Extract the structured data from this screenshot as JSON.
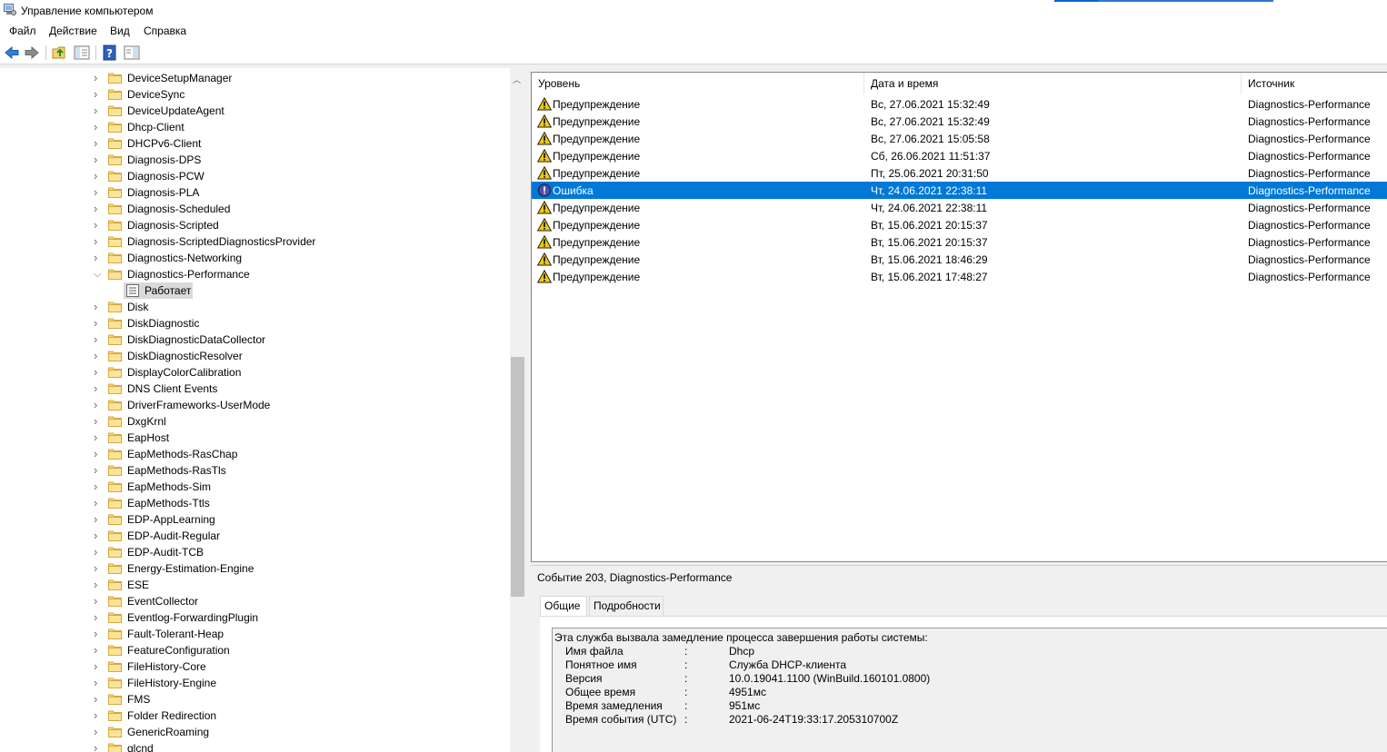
{
  "window": {
    "title": "Управление компьютером"
  },
  "menu": [
    "Файл",
    "Действие",
    "Вид",
    "Справка"
  ],
  "tree": {
    "items": [
      {
        "label": "DeviceSetupManager"
      },
      {
        "label": "DeviceSync"
      },
      {
        "label": "DeviceUpdateAgent"
      },
      {
        "label": "Dhcp-Client"
      },
      {
        "label": "DHCPv6-Client"
      },
      {
        "label": "Diagnosis-DPS"
      },
      {
        "label": "Diagnosis-PCW"
      },
      {
        "label": "Diagnosis-PLA"
      },
      {
        "label": "Diagnosis-Scheduled"
      },
      {
        "label": "Diagnosis-Scripted"
      },
      {
        "label": "Diagnosis-ScriptedDiagnosticsProvider"
      },
      {
        "label": "Diagnostics-Networking"
      },
      {
        "label": "Diagnostics-Performance",
        "expanded": true
      },
      {
        "label": "Работает",
        "child": true,
        "selected": true
      },
      {
        "label": "Disk"
      },
      {
        "label": "DiskDiagnostic"
      },
      {
        "label": "DiskDiagnosticDataCollector"
      },
      {
        "label": "DiskDiagnosticResolver"
      },
      {
        "label": "DisplayColorCalibration"
      },
      {
        "label": "DNS Client Events"
      },
      {
        "label": "DriverFrameworks-UserMode"
      },
      {
        "label": "DxgKrnl"
      },
      {
        "label": "EapHost"
      },
      {
        "label": "EapMethods-RasChap"
      },
      {
        "label": "EapMethods-RasTls"
      },
      {
        "label": "EapMethods-Sim"
      },
      {
        "label": "EapMethods-Ttls"
      },
      {
        "label": "EDP-AppLearning"
      },
      {
        "label": "EDP-Audit-Regular"
      },
      {
        "label": "EDP-Audit-TCB"
      },
      {
        "label": "Energy-Estimation-Engine"
      },
      {
        "label": "ESE"
      },
      {
        "label": "EventCollector"
      },
      {
        "label": "Eventlog-ForwardingPlugin"
      },
      {
        "label": "Fault-Tolerant-Heap"
      },
      {
        "label": "FeatureConfiguration"
      },
      {
        "label": "FileHistory-Core"
      },
      {
        "label": "FileHistory-Engine"
      },
      {
        "label": "FMS"
      },
      {
        "label": "Folder Redirection"
      },
      {
        "label": "GenericRoaming"
      },
      {
        "label": "glcnd"
      }
    ]
  },
  "events": {
    "columns": [
      "Уровень",
      "Дата и время",
      "Источник"
    ],
    "rows": [
      {
        "level": "Предупреждение",
        "type": "warning",
        "date": "Вс, 27.06.2021 15:32:49",
        "source": "Diagnostics-Performance"
      },
      {
        "level": "Предупреждение",
        "type": "warning",
        "date": "Вс, 27.06.2021 15:32:49",
        "source": "Diagnostics-Performance"
      },
      {
        "level": "Предупреждение",
        "type": "warning",
        "date": "Вс, 27.06.2021 15:05:58",
        "source": "Diagnostics-Performance"
      },
      {
        "level": "Предупреждение",
        "type": "warning",
        "date": "Сб, 26.06.2021 11:51:37",
        "source": "Diagnostics-Performance"
      },
      {
        "level": "Предупреждение",
        "type": "warning",
        "date": "Пт, 25.06.2021 20:31:50",
        "source": "Diagnostics-Performance"
      },
      {
        "level": "Ошибка",
        "type": "error",
        "date": "Чт, 24.06.2021 22:38:11",
        "source": "Diagnostics-Performance",
        "selected": true
      },
      {
        "level": "Предупреждение",
        "type": "warning",
        "date": "Чт, 24.06.2021 22:38:11",
        "source": "Diagnostics-Performance"
      },
      {
        "level": "Предупреждение",
        "type": "warning",
        "date": "Вт, 15.06.2021 20:15:37",
        "source": "Diagnostics-Performance"
      },
      {
        "level": "Предупреждение",
        "type": "warning",
        "date": "Вт, 15.06.2021 20:15:37",
        "source": "Diagnostics-Performance"
      },
      {
        "level": "Предупреждение",
        "type": "warning",
        "date": "Вт, 15.06.2021 18:46:29",
        "source": "Diagnostics-Performance"
      },
      {
        "level": "Предупреждение",
        "type": "warning",
        "date": "Вт, 15.06.2021 17:48:27",
        "source": "Diagnostics-Performance"
      }
    ]
  },
  "details": {
    "header": "Событие 203, Diagnostics-Performance",
    "tabs": [
      "Общие",
      "Подробности"
    ],
    "intro": "Эта служба вызвала замедление процесса завершения работы системы:",
    "separator": ":",
    "fields": [
      {
        "key": "Имя файла",
        "value": "Dhcp"
      },
      {
        "key": "Понятное имя",
        "value": "Служба DHCP-клиента"
      },
      {
        "key": "Версия",
        "value": "10.0.19041.1100 (WinBuild.160101.0800)"
      },
      {
        "key": "Общее время",
        "value": "4951мс"
      },
      {
        "key": "Время замедления",
        "value": "951мс"
      },
      {
        "key": "Время события (UTC)",
        "value": "2021-06-24T19:33:17.205310700Z"
      }
    ]
  },
  "colors": {
    "selection": "#0078d7",
    "warning": "#f2c811",
    "error": "#3b3e8c"
  }
}
